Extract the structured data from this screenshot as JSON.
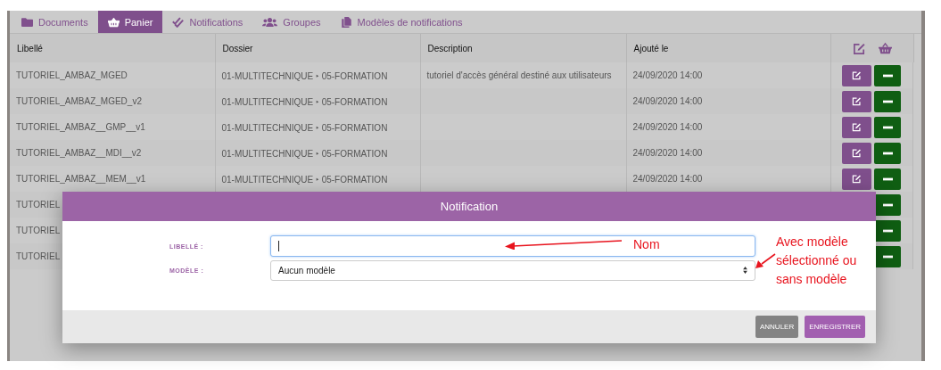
{
  "tabs": [
    {
      "label": "Documents",
      "selected": false
    },
    {
      "label": "Panier",
      "selected": true
    },
    {
      "label": "Notifications",
      "selected": false
    },
    {
      "label": "Groupes",
      "selected": false
    },
    {
      "label": "Modèles de notifications",
      "selected": false
    }
  ],
  "table": {
    "columns": [
      "Libellé",
      "Dossier",
      "Description",
      "Ajouté le"
    ],
    "rows": [
      {
        "libelle": "TUTORIEL_AMBAZ_MGED",
        "dossier": "01-MULTITECHNIQUE ‣ 05-FORMATION",
        "description": "tutoriel d'accès général destiné aux utilisateurs",
        "added": "24/09/2020 14:00"
      },
      {
        "libelle": "TUTORIEL_AMBAZ_MGED_v2",
        "dossier": "01-MULTITECHNIQUE ‣ 05-FORMATION",
        "added": "24/09/2020 14:00"
      },
      {
        "libelle": "TUTORIEL_AMBAZ__GMP__v1",
        "dossier": "01-MULTITECHNIQUE ‣ 05-FORMATION",
        "added": "24/09/2020 14:00"
      },
      {
        "libelle": "TUTORIEL_AMBAZ__MDI__v2",
        "dossier": "01-MULTITECHNIQUE ‣ 05-FORMATION",
        "added": "24/09/2020 14:00"
      },
      {
        "libelle": "TUTORIEL_AMBAZ__MEM__v1",
        "dossier": "01-MULTITECHNIQUE ‣ 05-FORMATION",
        "added": "24/09/2020 14:00"
      },
      {
        "libelle": "TUTORIEL"
      },
      {
        "libelle": "TUTORIEL"
      },
      {
        "libelle": "TUTORIEL"
      }
    ]
  },
  "modal": {
    "title": "Notification",
    "fields": [
      {
        "kind": "text",
        "label": "LIBELLÉ :",
        "focused": true
      },
      {
        "kind": "select",
        "label": "MODÈLE :",
        "value": "Aucun modèle"
      }
    ],
    "buttons": [
      {
        "label": "ANNULER",
        "kind": "secondary"
      },
      {
        "label": "ENREGISTRER",
        "kind": "primary"
      }
    ]
  },
  "annotations": [
    {
      "text": "Nom"
    },
    {
      "text": "Avec modèle sélectionné ou sans modèle"
    }
  ]
}
